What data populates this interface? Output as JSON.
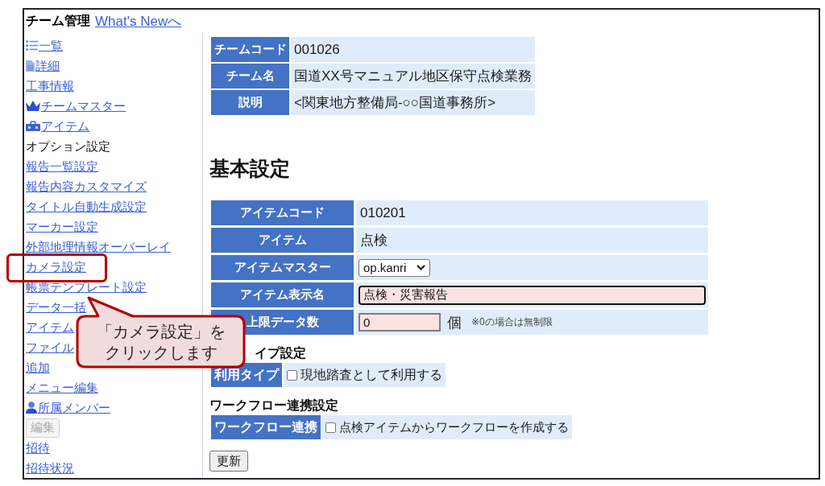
{
  "header": {
    "title": "チーム管理",
    "link": "What's Newへ"
  },
  "sidebar": {
    "items": [
      {
        "kind": "link",
        "label": "一覧",
        "disabled": false,
        "highlighted": false
      },
      {
        "kind": "link",
        "label": "詳細",
        "disabled": false,
        "highlighted": false
      },
      {
        "kind": "link",
        "label": "工事情報",
        "disabled": false,
        "highlighted": false
      },
      {
        "kind": "link",
        "label": "チームマスター",
        "disabled": false,
        "highlighted": false
      },
      {
        "kind": "link",
        "label": "アイテム",
        "disabled": false,
        "highlighted": false
      },
      {
        "kind": "text",
        "label": "オプション設定",
        "disabled": false,
        "highlighted": false
      },
      {
        "kind": "link",
        "label": "報告一覧設定",
        "disabled": false,
        "highlighted": false
      },
      {
        "kind": "link",
        "label": "報告内容カスタマイズ",
        "disabled": false,
        "highlighted": false
      },
      {
        "kind": "link",
        "label": "タイトル自動生成設定",
        "disabled": false,
        "highlighted": false
      },
      {
        "kind": "link",
        "label": "マーカー設定",
        "disabled": false,
        "highlighted": false
      },
      {
        "kind": "link",
        "label": "外部地理情報オーバーレイ",
        "disabled": false,
        "highlighted": false
      },
      {
        "kind": "link",
        "label": "カメラ設定",
        "disabled": false,
        "highlighted": true
      },
      {
        "kind": "link",
        "label": "帳票テンプレート設定",
        "disabled": false,
        "highlighted": false
      },
      {
        "kind": "link",
        "label": "データ一括",
        "disabled": false,
        "highlighted": false
      },
      {
        "kind": "link",
        "label": "アイテム",
        "disabled": false,
        "highlighted": false
      },
      {
        "kind": "link",
        "label": "ファイル",
        "disabled": false,
        "highlighted": false
      },
      {
        "kind": "link",
        "label": "追加",
        "disabled": false,
        "highlighted": false
      },
      {
        "kind": "link",
        "label": "メニュー編集",
        "disabled": false,
        "highlighted": false
      },
      {
        "kind": "link",
        "label": "所属メンバー",
        "disabled": false,
        "highlighted": false
      },
      {
        "kind": "button",
        "label": "編集",
        "disabled": true,
        "highlighted": false
      },
      {
        "kind": "link",
        "label": "招待",
        "disabled": false,
        "highlighted": false
      },
      {
        "kind": "link",
        "label": "招待状況",
        "disabled": false,
        "highlighted": false
      }
    ]
  },
  "team_info": {
    "rows": [
      {
        "label": "チームコード",
        "value": "001026"
      },
      {
        "label": "チーム名",
        "value": "国道XX号マニュアル地区保守点検業務"
      },
      {
        "label": "説明",
        "value": "<関東地方整備局-○○国道事務所>"
      }
    ]
  },
  "basic_settings": {
    "title": "基本設定",
    "rows": [
      {
        "kind": "text",
        "label": "アイテムコード",
        "value": "010201"
      },
      {
        "kind": "text",
        "label": "アイテム",
        "value": "点検"
      },
      {
        "kind": "select",
        "label": "アイテムマスター",
        "value": "op.kanri"
      },
      {
        "kind": "text_input",
        "label": "アイテム表示名",
        "value": "点検・災害報告",
        "focused": true
      },
      {
        "kind": "number_input",
        "label": "上限データ数",
        "value": "0",
        "focused": false,
        "unit": "個",
        "note": "※0の場合は無制限"
      }
    ]
  },
  "usage_type": {
    "title": "イプ設定",
    "label": "利用タイプ",
    "checkbox": {
      "label": "現地踏査として利用する",
      "checked": false
    }
  },
  "workflow": {
    "title": "ワークフロー連携設定",
    "label": "ワークフロー連携",
    "checkbox": {
      "label": "点検アイテムからワークフローを作成する",
      "checked": false
    }
  },
  "update_button": {
    "label": "更新"
  },
  "callout": {
    "lines": [
      "「カメラ設定」を",
      "クリックします"
    ]
  }
}
